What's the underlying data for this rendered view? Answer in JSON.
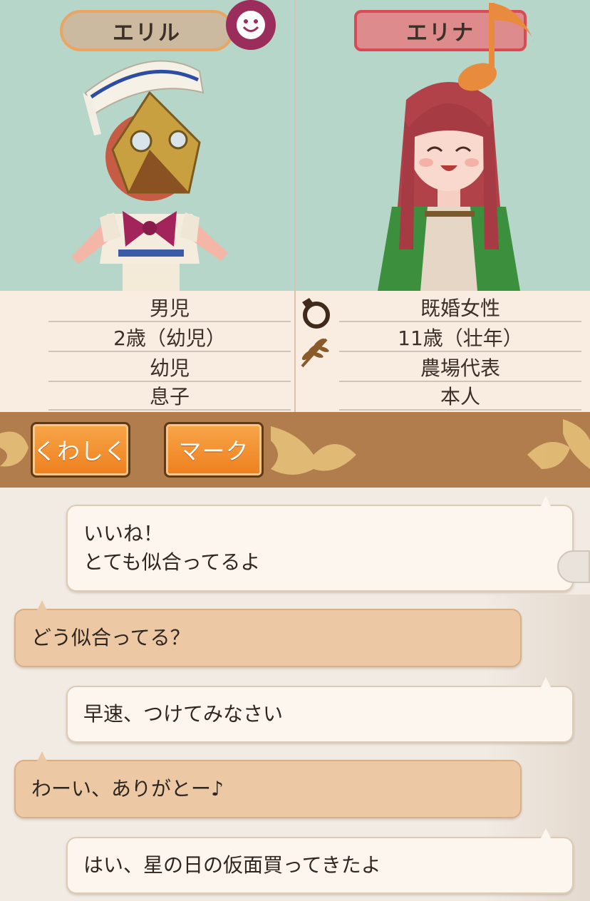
{
  "left_character": {
    "name": "エリル",
    "mood_icon": "smile-face-icon",
    "gender": "男児",
    "age": "2歳（幼児）",
    "job": "幼児",
    "relation": "息子"
  },
  "right_character": {
    "name": "エリナ",
    "mood_icon": "music-note-icon",
    "gender": "既婚女性",
    "age": "11歳（壮年）",
    "job": "農場代表",
    "relation": "本人",
    "status_icons": [
      "ring-icon",
      "wheat-icon"
    ]
  },
  "actions": {
    "detail_label": "くわしく",
    "mark_label": "マーク"
  },
  "chat": {
    "messages": [
      {
        "speaker": "self",
        "lines": [
          "いいね！",
          "とても似合ってるよ"
        ]
      },
      {
        "speaker": "other",
        "lines": [
          "どう似合ってる？"
        ]
      },
      {
        "speaker": "self",
        "lines": [
          "早速、つけてみなさい"
        ]
      },
      {
        "speaker": "other",
        "lines": [
          "わーい、ありがとー♪"
        ]
      },
      {
        "speaker": "self",
        "lines": [
          "はい、星の日の仮面買ってきたよ"
        ]
      }
    ]
  },
  "colors": {
    "portrait_bg": "#b5d6c9",
    "left_plate": "#cbb9a0",
    "right_plate": "#de8b8e",
    "button_orange": "#ee7f1d",
    "bar_brown": "#b27d4c",
    "self_bubble": "#fdf6ee",
    "other_bubble": "#ecc9a4"
  }
}
